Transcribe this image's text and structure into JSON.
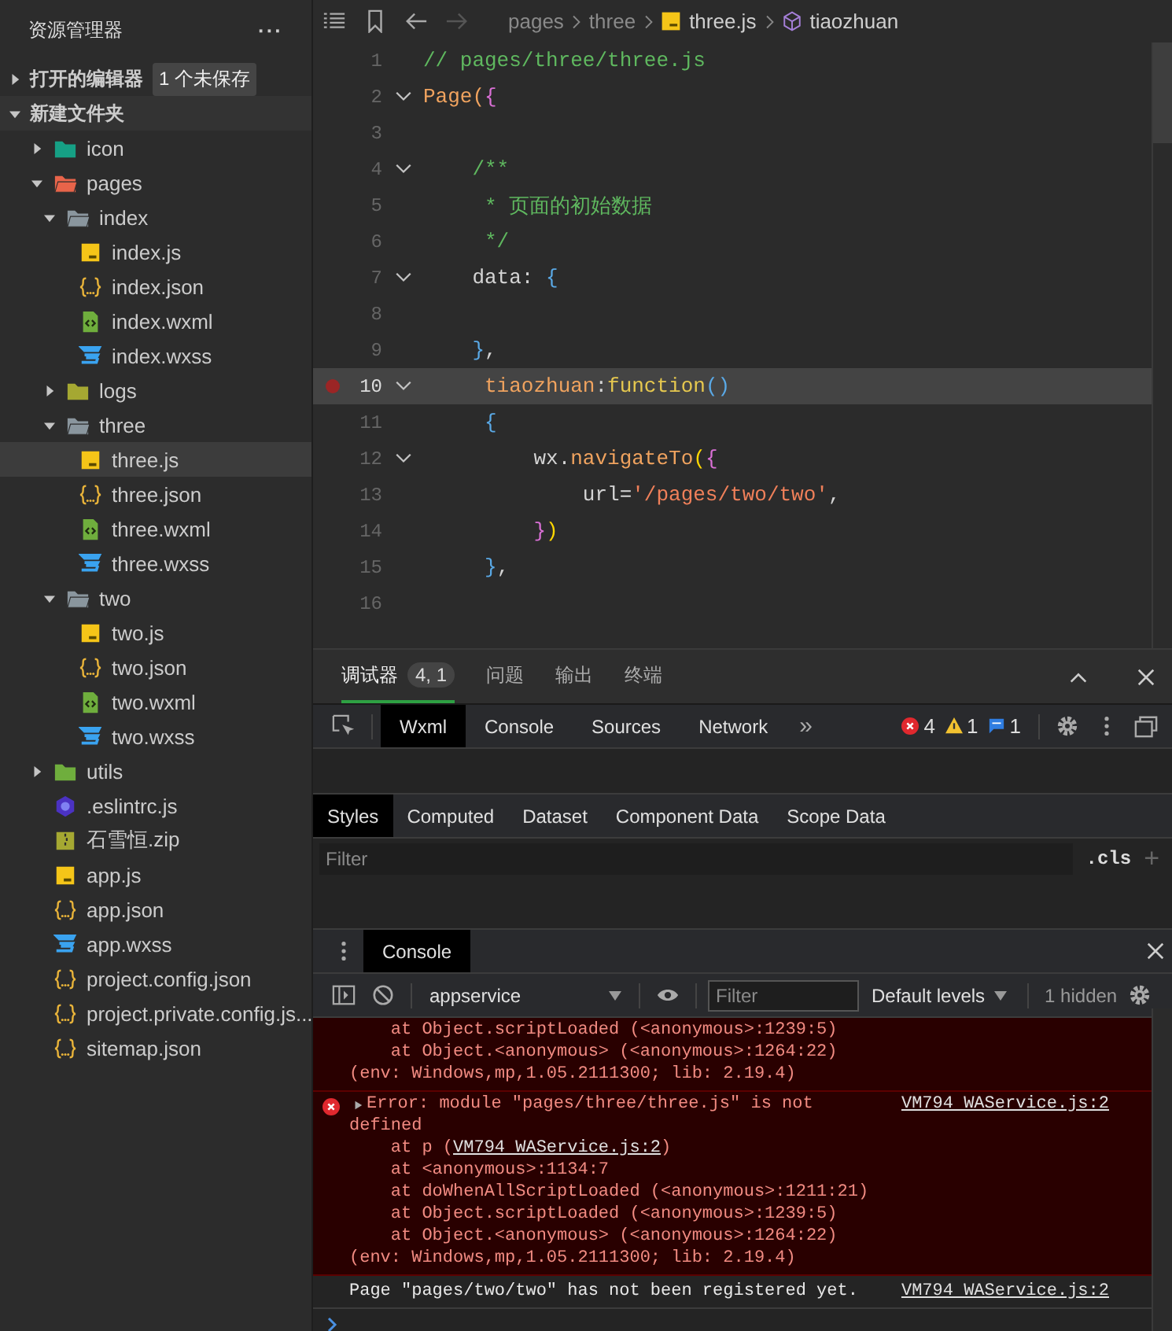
{
  "explorer": {
    "title": "资源管理器",
    "more": "···",
    "sections": [
      {
        "label": "打开的编辑器",
        "expanded": false,
        "badge": "1 个未保存"
      },
      {
        "label": "新建文件夹",
        "expanded": true
      }
    ],
    "tree": [
      {
        "name": "icon",
        "kind": "folder",
        "color": "#16a085",
        "expanded": false,
        "selected": false
      },
      {
        "name": "pages",
        "kind": "folder",
        "color": "#e8644a",
        "expanded": true,
        "selected": false,
        "children": [
          {
            "name": "index",
            "kind": "folder",
            "color": "#8a969e",
            "expanded": true,
            "selected": false,
            "children": [
              {
                "name": "index.js",
                "kind": "js",
                "selected": false
              },
              {
                "name": "index.json",
                "kind": "json",
                "selected": false
              },
              {
                "name": "index.wxml",
                "kind": "wxml",
                "selected": false
              },
              {
                "name": "index.wxss",
                "kind": "wxss",
                "selected": false
              }
            ]
          },
          {
            "name": "logs",
            "kind": "folder",
            "color": "#a5a832",
            "expanded": false,
            "selected": false
          },
          {
            "name": "three",
            "kind": "folder",
            "color": "#8a969e",
            "expanded": true,
            "selected": false,
            "children": [
              {
                "name": "three.js",
                "kind": "js",
                "selected": true
              },
              {
                "name": "three.json",
                "kind": "json",
                "selected": false
              },
              {
                "name": "three.wxml",
                "kind": "wxml",
                "selected": false
              },
              {
                "name": "three.wxss",
                "kind": "wxss",
                "selected": false
              }
            ]
          },
          {
            "name": "two",
            "kind": "folder",
            "color": "#8a969e",
            "expanded": true,
            "selected": false,
            "children": [
              {
                "name": "two.js",
                "kind": "js",
                "selected": false
              },
              {
                "name": "two.json",
                "kind": "json",
                "selected": false
              },
              {
                "name": "two.wxml",
                "kind": "wxml",
                "selected": false
              },
              {
                "name": "two.wxss",
                "kind": "wxss",
                "selected": false
              }
            ]
          }
        ]
      },
      {
        "name": "utils",
        "kind": "folder",
        "color": "#6fae3d",
        "expanded": false,
        "selected": false
      },
      {
        "name": ".eslintrc.js",
        "kind": "eslint",
        "selected": false
      },
      {
        "name": "石雪恒.zip",
        "kind": "zip",
        "selected": false
      },
      {
        "name": "app.js",
        "kind": "js",
        "selected": false
      },
      {
        "name": "app.json",
        "kind": "json",
        "selected": false
      },
      {
        "name": "app.wxss",
        "kind": "wxss",
        "selected": false
      },
      {
        "name": "project.config.json",
        "kind": "json",
        "selected": false
      },
      {
        "name": "project.private.config.js...",
        "kind": "json",
        "selected": false
      },
      {
        "name": "sitemap.json",
        "kind": "json",
        "selected": false
      }
    ]
  },
  "editor": {
    "breadcrumb": [
      {
        "text": "pages",
        "kind": "folder"
      },
      {
        "text": "three",
        "kind": "folder"
      },
      {
        "text": "three.js",
        "kind": "js"
      },
      {
        "text": "tiaozhuan",
        "kind": "symbol"
      }
    ],
    "lines": [
      {
        "number": "1",
        "fold": false,
        "breakpoint": false,
        "selected": false,
        "tokens": [
          {
            "text": "// pages/three/three.js",
            "kind": "comment"
          }
        ]
      },
      {
        "number": "2",
        "fold": true,
        "breakpoint": false,
        "selected": false,
        "tokens": [
          {
            "text": "Page(",
            "kind": "keyword"
          },
          {
            "text": "{",
            "kind": "bracket1"
          }
        ]
      },
      {
        "number": "3",
        "fold": false,
        "breakpoint": false,
        "selected": false
      },
      {
        "number": "4",
        "fold": true,
        "breakpoint": false,
        "selected": false,
        "tokens": [
          {
            "text": "    /**",
            "kind": "comment"
          }
        ]
      },
      {
        "number": "5",
        "fold": false,
        "breakpoint": false,
        "selected": false,
        "tokens": [
          {
            "text": "     * 页面的初始数据",
            "kind": "comment"
          }
        ]
      },
      {
        "number": "6",
        "fold": false,
        "breakpoint": false,
        "selected": false,
        "tokens": [
          {
            "text": "     */",
            "kind": "comment"
          }
        ]
      },
      {
        "number": "7",
        "fold": true,
        "breakpoint": false,
        "selected": false,
        "tokens": [
          {
            "text": "    data: ",
            "kind": "plain"
          },
          {
            "text": "{",
            "kind": "bracket2"
          }
        ]
      },
      {
        "number": "8",
        "fold": false,
        "breakpoint": false,
        "selected": false
      },
      {
        "number": "9",
        "fold": false,
        "breakpoint": false,
        "selected": false,
        "tokens": [
          {
            "text": "    }",
            "kind": "bracket2"
          },
          {
            "text": ",",
            "kind": "plain"
          }
        ]
      },
      {
        "number": "10",
        "fold": true,
        "breakpoint": true,
        "selected": true,
        "tokens": [
          {
            "text": "     tiaozhuan",
            "kind": "keyword"
          },
          {
            "text": ":",
            "kind": "plain"
          },
          {
            "text": "function",
            "kind": "func"
          },
          {
            "text": "()",
            "kind": "bracket2"
          }
        ]
      },
      {
        "number": "11",
        "fold": false,
        "breakpoint": false,
        "selected": false,
        "tokens": [
          {
            "text": "     {",
            "kind": "bracket2"
          }
        ]
      },
      {
        "number": "12",
        "fold": true,
        "breakpoint": false,
        "selected": false,
        "tokens": [
          {
            "text": "         wx.",
            "kind": "plain"
          },
          {
            "text": "navigateTo",
            "kind": "keyword"
          },
          {
            "text": "(",
            "kind": "bracket3"
          },
          {
            "text": "{",
            "kind": "bracket1"
          }
        ]
      },
      {
        "number": "13",
        "fold": false,
        "breakpoint": false,
        "selected": false,
        "tokens": [
          {
            "text": "             url=",
            "kind": "plain"
          },
          {
            "text": "'/pages/two/two'",
            "kind": "string"
          },
          {
            "text": ",",
            "kind": "plain"
          }
        ]
      },
      {
        "number": "14",
        "fold": false,
        "breakpoint": false,
        "selected": false,
        "tokens": [
          {
            "text": "         }",
            "kind": "bracket1"
          },
          {
            "text": ")",
            "kind": "bracket3"
          }
        ]
      },
      {
        "number": "15",
        "fold": false,
        "breakpoint": false,
        "selected": false,
        "tokens": [
          {
            "text": "     }",
            "kind": "bracket2"
          },
          {
            "text": ",",
            "kind": "plain"
          }
        ]
      },
      {
        "number": "16",
        "fold": false,
        "breakpoint": false,
        "selected": false
      }
    ]
  },
  "panel": {
    "tabs": [
      {
        "label": "调试器",
        "selected": true,
        "badge": "4, 1"
      },
      {
        "label": "问题",
        "selected": false
      },
      {
        "label": "输出",
        "selected": false
      },
      {
        "label": "终端",
        "selected": false
      }
    ]
  },
  "devtools": {
    "tabs": [
      {
        "label": "Wxml",
        "selected": true
      },
      {
        "label": "Console",
        "selected": false
      },
      {
        "label": "Sources",
        "selected": false
      },
      {
        "label": "Network",
        "selected": false
      }
    ],
    "more": "»",
    "errors": "4",
    "warnings": "1",
    "infos": "1",
    "style_tabs": [
      {
        "label": "Styles",
        "selected": true
      },
      {
        "label": "Computed",
        "selected": false
      },
      {
        "label": "Dataset",
        "selected": false
      },
      {
        "label": "Component Data",
        "selected": false
      },
      {
        "label": "Scope Data",
        "selected": false
      }
    ],
    "filter": {
      "placeholder": "Filter"
    },
    "cls": ".cls",
    "add": "+"
  },
  "console": {
    "tabs": [
      {
        "label": "Console",
        "selected": true
      }
    ],
    "context": "appservice",
    "filter": {
      "placeholder": "Filter"
    },
    "levels": "Default levels",
    "hidden": "1 hidden",
    "messages": [
      {
        "kind": "error",
        "lines": [
          {
            "text": "    at Object.scriptLoaded (<anonymous>:1239:5)"
          },
          {
            "text": "    at Object.<anonymous> (<anonymous>:1264:22)"
          },
          {
            "text": "(env: Windows,mp,1.05.2111300; lib: 2.19.4)"
          }
        ]
      },
      {
        "kind": "error",
        "expanded": false,
        "source": "VM794 WAService.js:2",
        "lines": [
          {
            "text": "Error: module \"pages/three/three.js\" is not"
          },
          {
            "text": "defined"
          },
          {
            "text": "    at p (",
            "link": "VM794 WAService.js:2",
            "after": ")"
          },
          {
            "text": "    at <anonymous>:1134:7"
          },
          {
            "text": "    at doWhenAllScriptLoaded (<anonymous>:1211:21)"
          },
          {
            "text": "    at Object.scriptLoaded (<anonymous>:1239:5)"
          },
          {
            "text": "    at Object.<anonymous> (<anonymous>:1264:22)"
          },
          {
            "text": "(env: Windows,mp,1.05.2111300; lib: 2.19.4)"
          }
        ]
      },
      {
        "kind": "log",
        "source": "VM794 WAService.js:2",
        "lines": [
          {
            "text": "Page \"pages/two/two\" has not been registered yet."
          }
        ]
      }
    ]
  }
}
